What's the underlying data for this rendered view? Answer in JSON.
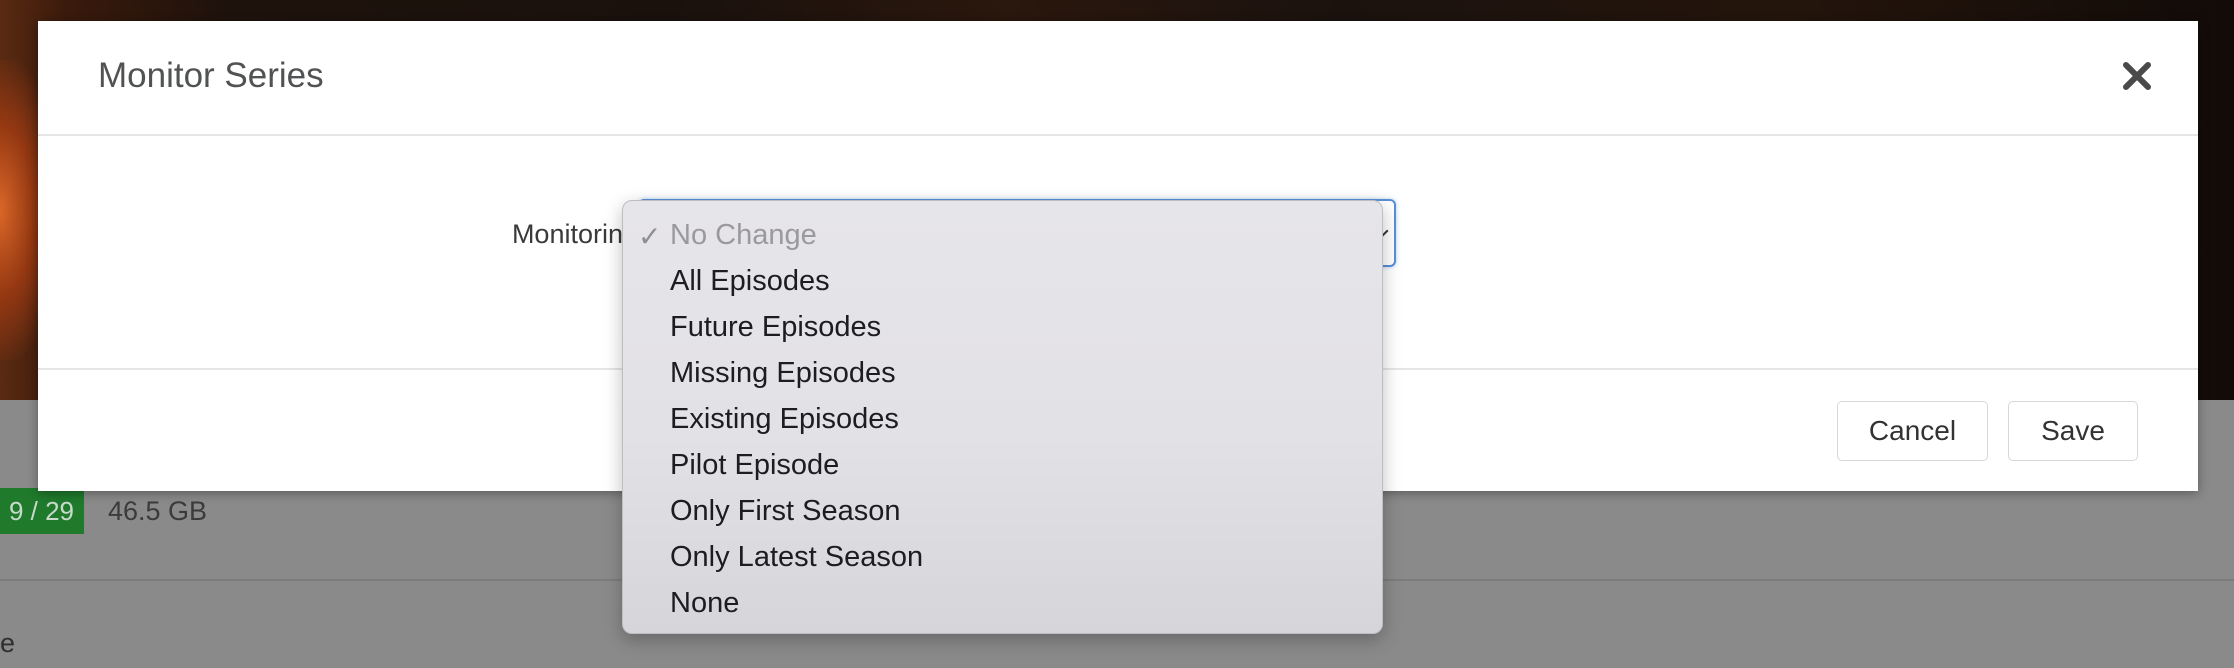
{
  "background": {
    "badge_text": "9 / 29",
    "size_text": "46.5 GB",
    "partial_text": "e"
  },
  "modal": {
    "title": "Monitor Series",
    "close_icon": "close-icon",
    "field_label": "Monitoring",
    "select_value": "No Change",
    "options": [
      {
        "label": "No Change",
        "selected": true,
        "disabled": true
      },
      {
        "label": "All Episodes",
        "selected": false,
        "disabled": false
      },
      {
        "label": "Future Episodes",
        "selected": false,
        "disabled": false
      },
      {
        "label": "Missing Episodes",
        "selected": false,
        "disabled": false
      },
      {
        "label": "Existing Episodes",
        "selected": false,
        "disabled": false
      },
      {
        "label": "Pilot Episode",
        "selected": false,
        "disabled": false
      },
      {
        "label": "Only First Season",
        "selected": false,
        "disabled": false
      },
      {
        "label": "Only Latest Season",
        "selected": false,
        "disabled": false
      },
      {
        "label": "None",
        "selected": false,
        "disabled": false
      }
    ],
    "checkmark": "✓",
    "cancel_label": "Cancel",
    "save_label": "Save"
  },
  "colors": {
    "badge_green": "#1f7a2c",
    "select_focus_border": "#5a8fd6",
    "title_text": "#515253"
  }
}
